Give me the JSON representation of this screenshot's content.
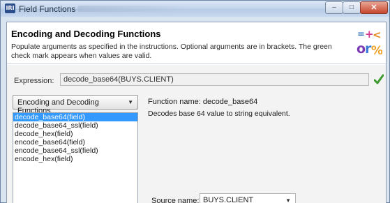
{
  "window": {
    "title": "Field Functions",
    "app_icon_text": "IRI",
    "minimize_glyph": "–",
    "maximize_glyph": "□",
    "close_glyph": "✕"
  },
  "header": {
    "title": "Encoding and Decoding Functions",
    "description": "Populate arguments as specified in the instructions. Optional arguments are in brackets. The green check mark appears when values are valid."
  },
  "expression": {
    "label": "Expression:",
    "value": "decode_base64(BUYS.CLIENT)",
    "valid_icon": "check-icon",
    "valid_color": "#3c9a2e"
  },
  "category": {
    "selected": "Encoding and Decoding Functions"
  },
  "functions": {
    "items": [
      "decode_base64(field)",
      "decode_base64_ssl(field)",
      "decode_hex(field)",
      "encode_base64(field)",
      "encode_base64_ssl(field)",
      "encode_hex(field)"
    ],
    "selected_index": 0,
    "selection_color": "#3399ff"
  },
  "details": {
    "function_name_label": "Function name:",
    "function_name": "decode_base64",
    "description": "Decodes base 64 value to string equivalent."
  },
  "source": {
    "label": "Source name:",
    "value": "BUYS.CLIENT"
  }
}
